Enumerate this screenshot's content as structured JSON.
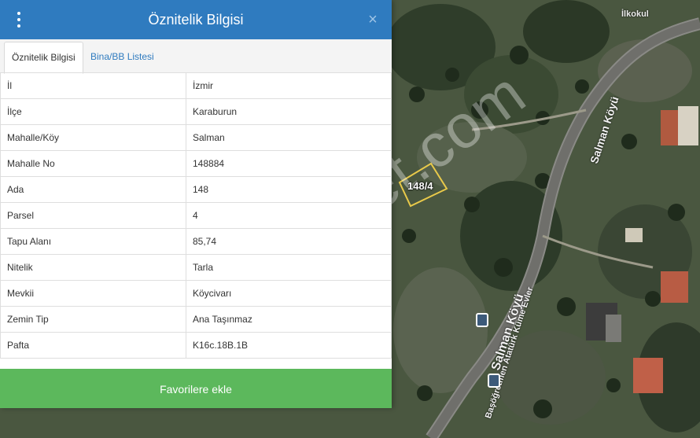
{
  "panel": {
    "title": "Öznitelik Bilgisi",
    "menu_icon": "vertical-ellipsis-icon",
    "close_icon": "close-icon",
    "close_label": "×",
    "tabs": [
      {
        "label": "Öznitelik Bilgisi",
        "active": true
      },
      {
        "label": "Bina/BB Listesi",
        "active": false
      }
    ],
    "attributes": [
      {
        "key": "İl",
        "value": "İzmir"
      },
      {
        "key": "İlçe",
        "value": "Karaburun"
      },
      {
        "key": "Mahalle/Köy",
        "value": "Salman"
      },
      {
        "key": "Mahalle No",
        "value": "148884"
      },
      {
        "key": "Ada",
        "value": "148"
      },
      {
        "key": "Parsel",
        "value": "4"
      },
      {
        "key": "Tapu Alanı",
        "value": "85,74"
      },
      {
        "key": "Nitelik",
        "value": "Tarla"
      },
      {
        "key": "Mevkii",
        "value": "Köyciv­arı"
      },
      {
        "key": "Zemin Tip",
        "value": "Ana Taşınmaz"
      },
      {
        "key": "Pafta",
        "value": "K16c.18B.1B"
      }
    ],
    "favorite_button": "Favorilere ekle"
  },
  "map": {
    "parcel_label": "148/4",
    "road_labels": [
      "Salman Köyü",
      "Salman Köyü",
      "Başöğretmen Atatürk Küme Evler"
    ],
    "poi_label": "İlkokul",
    "watermark": "emlakjet.com"
  },
  "colors": {
    "header": "#2f7bbf",
    "favorite": "#5cb85c",
    "tab_link": "#2f7bbf",
    "parcel_outline": "#e8c94a"
  }
}
